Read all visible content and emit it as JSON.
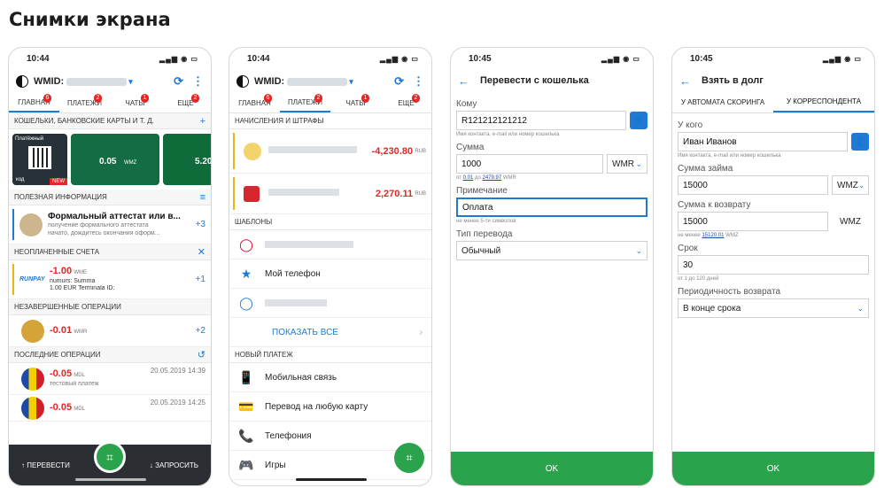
{
  "heading": "Снимки экрана",
  "status": {
    "time1": "10:44",
    "time2": "10:44",
    "time3": "10:45",
    "time4": "10:45",
    "icons": "▂▄▆ ◉ ▭"
  },
  "app": {
    "title": "WMID:"
  },
  "tabs": [
    {
      "label": "ГЛАВНАЯ",
      "badge": "6"
    },
    {
      "label": "ПЛАТЕЖИ",
      "badge": "2"
    },
    {
      "label": "ЧАТЫ",
      "badge": "1"
    },
    {
      "label": "ЕЩЕ",
      "badge": "2"
    }
  ],
  "screen1": {
    "wallets_section": "КОШЕЛЬКИ, БАНКОВСКИЕ КАРТЫ И Т. Д.",
    "card1_label": "Платёжный",
    "card1_code": "код",
    "card1_new": "NEW",
    "card2_amount": "0.05",
    "card2_unit": "WMZ",
    "card3_amount": "5.20",
    "useful_section": "ПОЛЕЗНАЯ ИНФОРМАЦИЯ",
    "info_title": "Формальный аттестат или в...",
    "info_sub1": "получение формального аттестата",
    "info_sub2": "начато, дождитесь окончания оформ...",
    "info_plus": "+3",
    "unpaid_section": "НЕОПЛАЧЕННЫЕ СЧЕТА",
    "bill_logo": "RUNPAY",
    "bill_amount": "-1.00",
    "bill_unit": "WME",
    "bill_line1": "numurs:",
    "bill_line1b": "Summa",
    "bill_line2": "1.00 EUR",
    "bill_line2b": "Terminala ID:",
    "bill_plus": "+1",
    "pending_section": "НЕЗАВЕРШЕННЫЕ ОПЕРАЦИИ",
    "pending_amount": "-0.01",
    "pending_unit": "WMR",
    "pending_plus": "+2",
    "recent_section": "ПОСЛЕДНИЕ ОПЕРАЦИИ",
    "op1_amount": "-0.05",
    "op1_unit": "MDL",
    "op1_date": "20.05.2019 14:39",
    "op1_desc": "тестовый платеж",
    "op2_amount": "-0.05",
    "op2_unit": "MDL",
    "op2_date": "20.05.2019 14:25",
    "send": "ПЕРЕВЕСТИ",
    "request": "ЗАПРОСИТЬ"
  },
  "screen2": {
    "fines_section": "НАЧИСЛЕНИЯ И ШТРАФЫ",
    "fine1_amount": "-4,230.80",
    "fine1_unit": "RUB",
    "fine2_amount": "2,270.11",
    "fine2_unit": "RUB",
    "templates_section": "ШАБЛОНЫ",
    "tpl2": "Мой телефон",
    "show_all": "ПОКАЗАТЬ ВСЕ",
    "new_section": "НОВЫЙ ПЛАТЕЖ",
    "np1": "Мобильная связь",
    "np2": "Перевод на любую карту",
    "np3": "Телефония",
    "np4": "Игры"
  },
  "screen3": {
    "title": "Перевести с кошелька",
    "to_label": "Кому",
    "to_value": "R121212121212",
    "to_hint": "Имя контакта, e-mail или номер кошелька",
    "amount_label": "Сумма",
    "amount_value": "1000",
    "currency": "WMR",
    "range_from": "от",
    "range_min": "0.01",
    "range_to": "до",
    "range_max": "2479.97",
    "range_unit": "WMR",
    "note_label": "Примечание",
    "note_value": "Оплата",
    "note_hint": "не менее 5-ти символов",
    "type_label": "Тип перевода",
    "type_value": "Обычный",
    "ok": "OK"
  },
  "screen4": {
    "title": "Взять в долг",
    "tab1": "У АВТОМАТА СКОРИНГА",
    "tab2": "У КОРРЕСПОНДЕНТА",
    "from_label": "У кого",
    "from_value": "Иван Иванов",
    "from_hint": "Имя контакта, e-mail или номер кошелька",
    "loan_label": "Сумма займа",
    "loan_value": "15000",
    "loan_currency": "WMZ",
    "return_label": "Сумма к возврату",
    "return_value": "15000",
    "return_unit": "WMZ",
    "return_hint_a": "не менее",
    "return_hint_val": "15120.01",
    "return_hint_unit": "WMZ",
    "term_label": "Срок",
    "term_value": "30",
    "term_hint": "от 1 до 120 дней",
    "period_label": "Периодичность возврата",
    "period_value": "В конце срока",
    "ok": "OK"
  }
}
